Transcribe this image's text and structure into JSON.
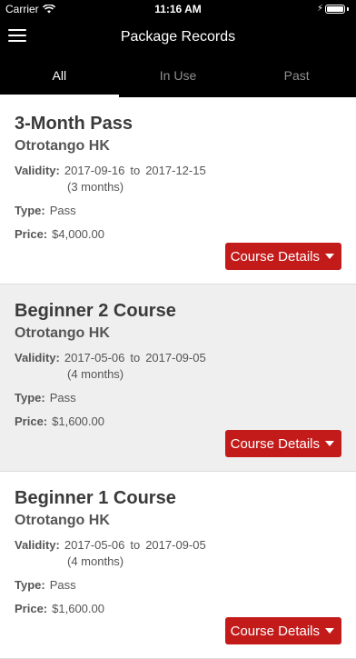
{
  "status_bar": {
    "carrier": "Carrier",
    "time": "11:16 AM"
  },
  "header": {
    "title": "Package Records"
  },
  "tabs": [
    {
      "label": "All",
      "active": true
    },
    {
      "label": "In Use",
      "active": false
    },
    {
      "label": "Past",
      "active": false
    }
  ],
  "labels": {
    "validity": "Validity:",
    "type": "Type:",
    "price": "Price:",
    "to": "to",
    "details": "Course Details"
  },
  "packages": [
    {
      "title": "3-Month Pass",
      "org": "Otrotango HK",
      "from": "2017-09-16",
      "until": "2017-12-15",
      "duration": "(3 months)",
      "type": "Pass",
      "price": "$4,000.00"
    },
    {
      "title": "Beginner 2 Course",
      "org": "Otrotango HK",
      "from": "2017-05-06",
      "until": "2017-09-05",
      "duration": "(4 months)",
      "type": "Pass",
      "price": "$1,600.00"
    },
    {
      "title": "Beginner 1 Course",
      "org": "Otrotango HK",
      "from": "2017-05-06",
      "until": "2017-09-05",
      "duration": "(4 months)",
      "type": "Pass",
      "price": "$1,600.00"
    }
  ],
  "colors": {
    "accent": "#c31a1a",
    "header": "#000000",
    "alt_row": "#efefef"
  }
}
